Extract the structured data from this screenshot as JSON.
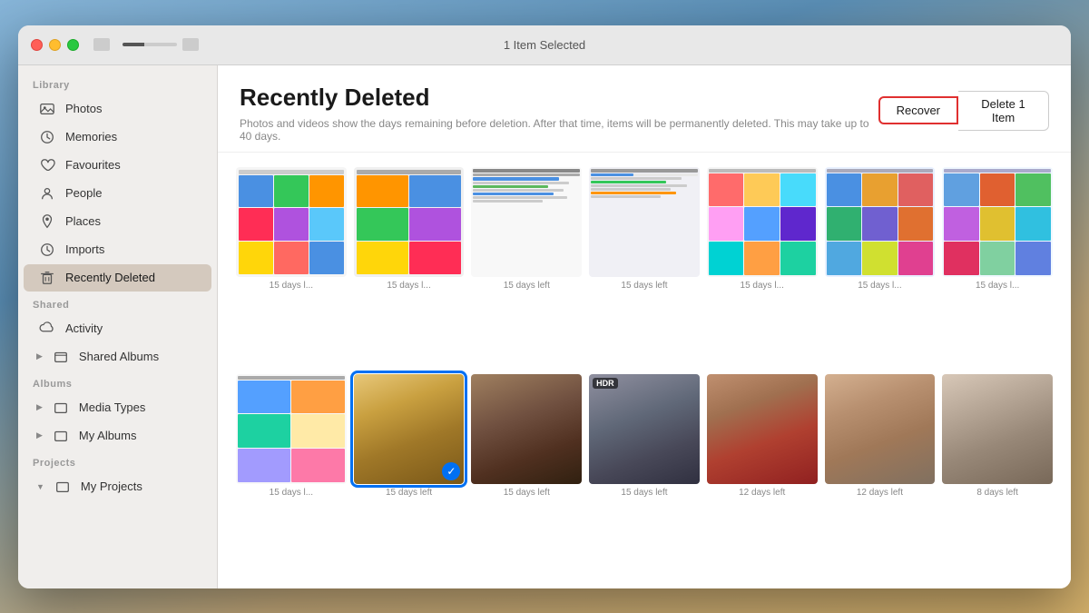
{
  "window": {
    "title": "1 Item Selected"
  },
  "sidebar": {
    "library_label": "Library",
    "shared_label": "Shared",
    "albums_label": "Albums",
    "projects_label": "Projects",
    "items": [
      {
        "id": "photos",
        "label": "Photos",
        "icon": "photo"
      },
      {
        "id": "memories",
        "label": "Memories",
        "icon": "memories"
      },
      {
        "id": "favourites",
        "label": "Favourites",
        "icon": "heart"
      },
      {
        "id": "people",
        "label": "People",
        "icon": "person"
      },
      {
        "id": "places",
        "label": "Places",
        "icon": "pin"
      },
      {
        "id": "imports",
        "label": "Imports",
        "icon": "clock"
      },
      {
        "id": "recently-deleted",
        "label": "Recently Deleted",
        "icon": "trash",
        "active": true
      },
      {
        "id": "activity",
        "label": "Activity",
        "icon": "cloud"
      },
      {
        "id": "shared-albums",
        "label": "Shared Albums",
        "icon": "folder",
        "arrow": true
      },
      {
        "id": "media-types",
        "label": "Media Types",
        "icon": "folder",
        "arrow": true
      },
      {
        "id": "my-albums",
        "label": "My Albums",
        "icon": "folder",
        "arrow": true
      },
      {
        "id": "my-projects",
        "label": "My Projects",
        "icon": "folder",
        "arrow-down": true
      }
    ]
  },
  "content": {
    "title": "Recently Deleted",
    "subtitle": "Photos and videos show the days remaining before deletion. After that time, items will be permanently deleted. This may take up to 40 days.",
    "recover_button": "Recover",
    "delete_button": "Delete 1 Item",
    "photos": [
      {
        "label": "15 days l...",
        "type": "phone-colorful",
        "row": 1
      },
      {
        "label": "15 days l...",
        "type": "phone-colorful2",
        "row": 1
      },
      {
        "label": "15 days left",
        "type": "phone-settings",
        "row": 1
      },
      {
        "label": "15 days left",
        "type": "phone-shortcuts",
        "row": 1
      },
      {
        "label": "15 days l...",
        "type": "phone-colorful3",
        "row": 1
      },
      {
        "label": "15 days l...",
        "type": "phone-colorful4",
        "row": 1
      },
      {
        "label": "15 days l...",
        "type": "phone-colorful5",
        "row": 1
      },
      {
        "label": "15 days l...",
        "type": "phone-gallery",
        "row": 2
      },
      {
        "label": "15 days left",
        "type": "child-yellow-jacket",
        "selected": true,
        "row": 2
      },
      {
        "label": "15 days left",
        "type": "dark-room",
        "row": 2
      },
      {
        "label": "15 days left",
        "type": "bedroom-hdr",
        "hdr": true,
        "row": 2
      },
      {
        "label": "12 days left",
        "type": "child-red",
        "row": 2
      },
      {
        "label": "12 days left",
        "type": "child-close",
        "row": 2
      },
      {
        "label": "8 days left",
        "type": "child-eating",
        "row": 2
      }
    ]
  }
}
